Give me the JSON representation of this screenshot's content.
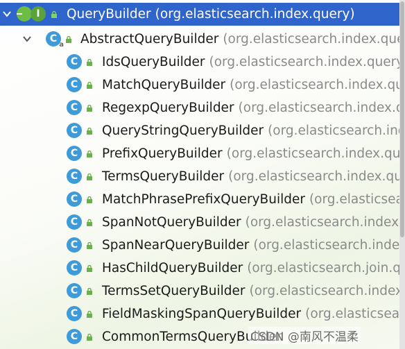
{
  "tree": {
    "root": {
      "name": "QueryBuilder",
      "package": "(org.elasticsearch.index.query)",
      "icon": "interface-icon",
      "selected": true,
      "expanded": true
    },
    "parent": {
      "name": "AbstractQueryBuilder",
      "package": "(org.elasticsearch.index.query",
      "icon": "abstract-class-icon",
      "expanded": true
    },
    "children": [
      {
        "name": "IdsQueryBuilder",
        "package": "(org.elasticsearch.index.query)"
      },
      {
        "name": "MatchQueryBuilder",
        "package": "(org.elasticsearch.index.que"
      },
      {
        "name": "RegexpQueryBuilder",
        "package": "(org.elasticsearch.index.qu"
      },
      {
        "name": "QueryStringQueryBuilder",
        "package": "(org.elasticsearch.ind"
      },
      {
        "name": "PrefixQueryBuilder",
        "package": "(org.elasticsearch.index.que"
      },
      {
        "name": "TermsQueryBuilder",
        "package": "(org.elasticsearch.index.que"
      },
      {
        "name": "MatchPhrasePrefixQueryBuilder",
        "package": "(org.elasticsear"
      },
      {
        "name": "SpanNotQueryBuilder",
        "package": "(org.elasticsearch.index.q"
      },
      {
        "name": "SpanNearQueryBuilder",
        "package": "(org.elasticsearch.index"
      },
      {
        "name": "HasChildQueryBuilder",
        "package": "(org.elasticsearch.join.qu"
      },
      {
        "name": "TermsSetQueryBuilder",
        "package": "(org.elasticsearch.index."
      },
      {
        "name": "FieldMaskingSpanQueryBuilder",
        "package": "(org.elasticsearc"
      },
      {
        "name": "CommonTermsQueryBuilder",
        "package": ""
      }
    ]
  },
  "watermark": "CSDN @南风不温柔",
  "colors": {
    "selection": "#2f65ca",
    "class_icon": "#3f9ad8",
    "interface_icon": "#5aa33a",
    "lock": "#6ab04c",
    "package_text": "#8a8a8a"
  }
}
